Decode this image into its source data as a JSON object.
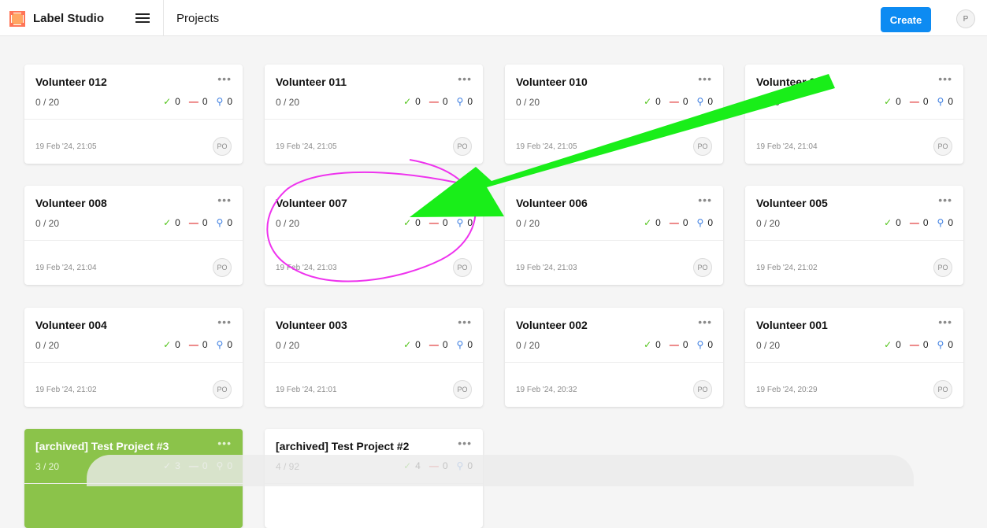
{
  "app": {
    "brand": "Label Studio",
    "page_title": "Projects",
    "create_label": "Create",
    "avatar_initial": "P"
  },
  "colors": {
    "accent": "#0d8bf2",
    "archived": "#8bc34a",
    "annotation_arrow": "#19ee19",
    "annotation_circle": "#ee33ee"
  },
  "projects": [
    {
      "title": "Volunteer 012",
      "progress": "0 / 20",
      "completed": "0",
      "skipped": "0",
      "predicted": "0",
      "date": "19 Feb '24, 21:05",
      "owner": "PO"
    },
    {
      "title": "Volunteer 011",
      "progress": "0 / 20",
      "completed": "0",
      "skipped": "0",
      "predicted": "0",
      "date": "19 Feb '24, 21:05",
      "owner": "PO"
    },
    {
      "title": "Volunteer 010",
      "progress": "0 / 20",
      "completed": "0",
      "skipped": "0",
      "predicted": "0",
      "date": "19 Feb '24, 21:05",
      "owner": "PO"
    },
    {
      "title": "Volunteer 009",
      "progress": "0 / 20",
      "completed": "0",
      "skipped": "0",
      "predicted": "0",
      "date": "19 Feb '24, 21:04",
      "owner": "PO"
    },
    {
      "title": "Volunteer 008",
      "progress": "0 / 20",
      "completed": "0",
      "skipped": "0",
      "predicted": "0",
      "date": "19 Feb '24, 21:04",
      "owner": "PO"
    },
    {
      "title": "Volunteer 007",
      "progress": "0 / 20",
      "completed": "0",
      "skipped": "0",
      "predicted": "0",
      "date": "19 Feb '24, 21:03",
      "owner": "PO"
    },
    {
      "title": "Volunteer 006",
      "progress": "0 / 20",
      "completed": "0",
      "skipped": "0",
      "predicted": "0",
      "date": "19 Feb '24, 21:03",
      "owner": "PO"
    },
    {
      "title": "Volunteer 005",
      "progress": "0 / 20",
      "completed": "0",
      "skipped": "0",
      "predicted": "0",
      "date": "19 Feb '24, 21:02",
      "owner": "PO"
    },
    {
      "title": "Volunteer 004",
      "progress": "0 / 20",
      "completed": "0",
      "skipped": "0",
      "predicted": "0",
      "date": "19 Feb '24, 21:02",
      "owner": "PO"
    },
    {
      "title": "Volunteer 003",
      "progress": "0 / 20",
      "completed": "0",
      "skipped": "0",
      "predicted": "0",
      "date": "19 Feb '24, 21:01",
      "owner": "PO"
    },
    {
      "title": "Volunteer 002",
      "progress": "0 / 20",
      "completed": "0",
      "skipped": "0",
      "predicted": "0",
      "date": "19 Feb '24, 20:32",
      "owner": "PO"
    },
    {
      "title": "Volunteer 001",
      "progress": "0 / 20",
      "completed": "0",
      "skipped": "0",
      "predicted": "0",
      "date": "19 Feb '24, 20:29",
      "owner": "PO"
    },
    {
      "title": "[archived] Test Project #3",
      "progress": "3 / 20",
      "completed": "3",
      "skipped": "0",
      "predicted": "0",
      "date": "",
      "owner": ""
    },
    {
      "title": "[archived] Test Project #2",
      "progress": "4 / 92",
      "completed": "4",
      "skipped": "0",
      "predicted": "0",
      "date": "",
      "owner": ""
    }
  ],
  "icons": {
    "completed": "check-icon",
    "skipped": "minus-icon",
    "predicted": "lightbulb-icon",
    "more": "ellipsis-icon"
  }
}
